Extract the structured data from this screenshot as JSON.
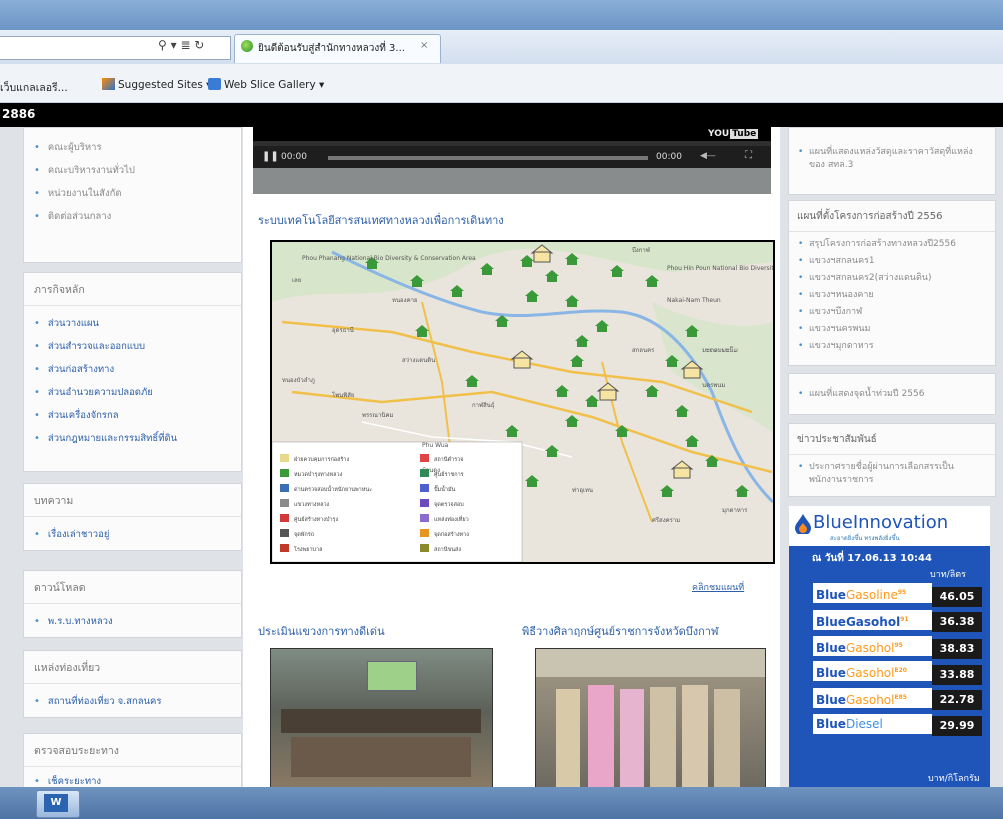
{
  "browser": {
    "tab_title": "ยินดีต้อนรับสู่สำนักทางหลวงที่ 3...",
    "tab_close": "×",
    "address_icons": "⚲ ▾ ≣ ↻"
  },
  "favorites": {
    "items": [
      {
        "label": "เว็บแกลเลอรี...",
        "icon": "favorite-page-icon"
      },
      {
        "label": "Suggested Sites ▾",
        "icon": "suggested-sites-icon"
      },
      {
        "label": "Web Slice Gallery ▾",
        "icon": "web-slice-icon"
      }
    ]
  },
  "topbar": {
    "text": "2886"
  },
  "sidebar": {
    "panel1": {
      "items": [
        "คณะผู้บริหาร",
        "คณะบริหารงานทั่วไป",
        "หน่วยงานในสังกัด",
        "ติดต่อส่วนกลาง"
      ]
    },
    "panel2": {
      "title": "ภารกิจหลัก",
      "items": [
        "ส่วนวางแผน",
        "ส่วนสำรวจและออกแบบ",
        "ส่วนก่อสร้างทาง",
        "ส่วนอำนวยความปลอดภัย",
        "ส่วนเครื่องจักรกล",
        "ส่วนกฎหมายและกรรมสิทธิ์ที่ดิน"
      ]
    },
    "panel3": {
      "title": "บทความ",
      "items": [
        "เรื่องเล่าชาวอยู่"
      ]
    },
    "panel4": {
      "title": "ดาวน์โหลด",
      "items": [
        "พ.ร.บ.ทางหลวง"
      ]
    },
    "panel5": {
      "title": "แหล่งท่องเที่ยว",
      "items": [
        "สถานที่ท่องเที่ยว จ.สกลนคร"
      ]
    },
    "panel6": {
      "title": "ตรวจสอบระยะทาง",
      "items": [
        "เช็คระยะทาง"
      ]
    }
  },
  "video": {
    "badge": "YOU",
    "play_icon": "❚❚",
    "time_start": "00:00",
    "time_end": "00:00",
    "volume_icon": "◀—",
    "fullscreen_icon": "⛶"
  },
  "main": {
    "section_title": "ระบบเทคโนโลยีสารสนเทศทางหลวงเพื่อการเดินทาง",
    "map_link": "คลิกชมแผนที่",
    "news1_title": "ประเมินแขวงการทางดีเด่น",
    "news2_title": "พิธีวางศิลาฤกษ์ศูนย์ราชการจังหวัดบึงกาฬ"
  },
  "map": {
    "legend": [
      "ฝ่ายควบคุมการก่อสร้าง",
      "หมวดบำรุงทางหลวง",
      "ด่านตรวจสอบน้ำหนักยานพาหนะ",
      "แขวงทางหลวง",
      "ศูนย์สร้างทางบำรุง",
      "จุดพักรถ",
      "โรงพยาบาล",
      "สถานีตำรวจ",
      "ศูนย์ราชการ",
      "ปั๊มน้ำมัน",
      "จุดตรวจสอบ",
      "แหล่งท่องเที่ยว",
      "จุดก่อสร้างทาง",
      "สถานีขนส่ง"
    ],
    "labels": [
      "Phou Phanang National Bio Diversity & Conservation Area",
      "Phou Hin Poun National Bio Diversity Conservation Area",
      "Nakai-Nam Theun",
      "ນະຄອນພະນົມ",
      "Phu Wua",
      "สกลนคร",
      "นครพนม",
      "เลย",
      "บึงกาฬ",
      "อุดรธานี",
      "หนองคาย",
      "หนองบัวลำภู",
      "สว่างแดนดิน",
      "กาฬสินธุ์",
      "มุกดาหาร",
      "ท่าอุเทน",
      "ศรีสงคราม",
      "พรรณานิคม",
      "บ้านดุง",
      "โพนพิสัย"
    ]
  },
  "right": {
    "panel1": {
      "items": [
        "แผนที่แสดงแหล่งวัสดุและราคาวัสดุที่แหล่งของ สทล.3"
      ]
    },
    "panel2": {
      "title": "แผนที่ตั้งโครงการก่อสร้างปี 2556",
      "items": [
        "สรุปโครงการก่อสร้างทางหลวงปี2556",
        "แขวงฯสกลนคร1",
        "แขวงฯสกลนคร2(สว่างแดนดิน)",
        "แขวงฯหนองคาย",
        "แขวงฯบึงกาฬ",
        "แขวงฯนครพนม",
        "แขวงฯมุกดาหาร"
      ]
    },
    "panel3": {
      "items": [
        "แผนที่แสดงจุดน้ำท่วมปี 2556"
      ]
    },
    "panel4": {
      "title": "ข่าวประชาสัมพันธ์",
      "items": [
        "ประกาศรายชื่อผู้ผ่านการเลือกสรรเป็นพนักงานราชการ"
      ]
    }
  },
  "fuel": {
    "brand": "BlueInnovation",
    "sub": "สะอาดยิ่งขึ้น ทรงพลังยิ่งขึ้น",
    "date": "ณ วันที่ 17.06.13 10:44",
    "unit": "บาท/ลิตร",
    "unit2": "บาท/กิโลกรัม",
    "rows": [
      {
        "base": "Blue",
        "hl": "Gasoline",
        "suffix": "95",
        "price": "46.05"
      },
      {
        "base": "BlueGasohol",
        "hl": "",
        "suffix": "91",
        "price": "36.38"
      },
      {
        "base": "Blue",
        "hl": "Gasohol",
        "suffix": "95",
        "price": "38.83"
      },
      {
        "base": "Blue",
        "hl": "Gasohol",
        "suffix": "E20",
        "price": "33.88"
      },
      {
        "base": "Blue",
        "hl": "Gasohol",
        "suffix": "E85",
        "price": "22.78"
      },
      {
        "base": "Blue",
        "hl": "Diesel",
        "suffix": "",
        "price": "29.99"
      }
    ]
  },
  "taskbar": {
    "app_label": "W"
  },
  "colors": {
    "link": "#2c5fa8",
    "fuel_blue": "#1f55b8",
    "pin_green": "#3a9a3a",
    "accent_orange": "#ff9a1a"
  }
}
